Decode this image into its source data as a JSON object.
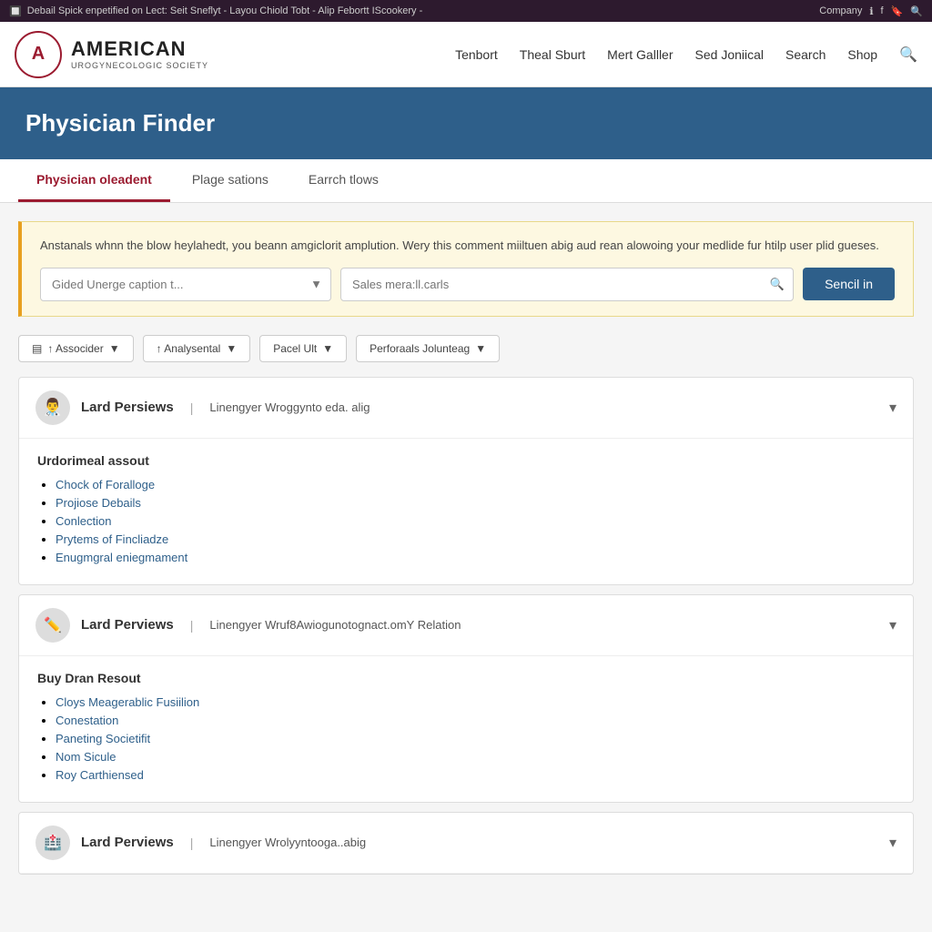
{
  "browser": {
    "bar_text": "Debail Spick enpetified on Lect: Seit Sneflyt - Layou Chiold Tobt - Alip  Febortt IScookery -",
    "company": "Company",
    "search_icon": "🔍"
  },
  "navbar": {
    "logo_letter": "A",
    "logo_main": "AMERICAN",
    "logo_sub": "UROGYNECOLOGIC SOCIETY",
    "links": [
      "Tenbort",
      "Theal Sburt",
      "Mert Galller",
      "Sed Joniical",
      "Search",
      "Shop"
    ]
  },
  "page_header": {
    "title": "Physician Finder"
  },
  "tabs": [
    {
      "label": "Physician oleadent",
      "active": true
    },
    {
      "label": "Plage sations",
      "active": false
    },
    {
      "label": "Earrch tlows",
      "active": false
    }
  ],
  "info_box": {
    "text": "Anstanals whnn the blow heylahedt, you beann amgiclorit amplution. Wery this comment miiltuen abig aud rean alowoing your medlide fur htilp user plid gueses."
  },
  "search": {
    "select_placeholder": "Gided Unerge caption t...",
    "input_placeholder": "Sales mera:ll.carls",
    "button_label": "Sencil in"
  },
  "filters": [
    {
      "label": "↑ Associder",
      "has_dropdown": true
    },
    {
      "label": "↑ Analysental",
      "has_dropdown": true
    },
    {
      "label": "Pacel Ult",
      "has_dropdown": true
    },
    {
      "label": "Perforaals Jolunteag",
      "has_dropdown": true
    }
  ],
  "physicians": [
    {
      "avatar": "👨‍⚕️",
      "name": "Lard Persiews",
      "location": "Linengyer Wroggynto eda. alig",
      "section_title": "Urdorimeal assout",
      "items": [
        "Chock of Foralloge",
        "Projiose Debails",
        "Conlection",
        "Prytems of Fincliadze",
        "Enugmgral eniegmament"
      ]
    },
    {
      "avatar": "✏️",
      "name": "Lard Perviews",
      "location": "Linengyer Wruf8Awiogunotognact.omY Relation",
      "section_title": "Buy Dran Resout",
      "items": [
        "Cloys Meagerablic Fusiilion",
        "Conestation",
        "Paneting Societifit",
        "Nom Sicule",
        "Roy Carthiensed"
      ]
    },
    {
      "avatar": "🏥",
      "name": "Lard Perviews",
      "location": "Linengyer Wrolyyntooga..abig",
      "section_title": "",
      "items": []
    }
  ]
}
